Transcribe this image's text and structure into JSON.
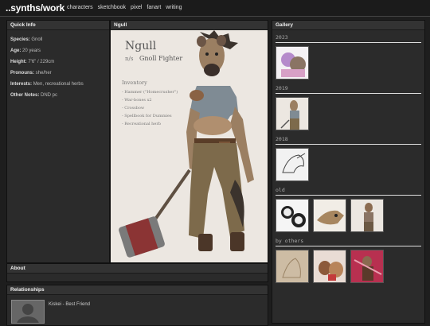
{
  "site": {
    "title": "..synths/work",
    "nav": [
      "characters",
      "sketchbook",
      "pixel",
      "fanart",
      "writing"
    ]
  },
  "quick_info": {
    "header": "Quick Info",
    "rows": [
      {
        "label": "Species:",
        "value": "Gnoll"
      },
      {
        "label": "Age:",
        "value": "20 years"
      },
      {
        "label": "Height:",
        "value": "7'6\" / 229cm"
      },
      {
        "label": "Pronouns:",
        "value": "she/her"
      },
      {
        "label": "Interests:",
        "value": "Men, recreational herbs"
      },
      {
        "label": "Other Notes:",
        "value": "DND pc"
      }
    ]
  },
  "character": {
    "header": "Ngull",
    "art": {
      "name": "Ngull",
      "subtitle": "Gnoll Fighter",
      "prefix": "n/s",
      "inventory_title": "Inventory",
      "inventory": [
        "- Hammer (\"Homecrusher\")",
        "- War-bones x2",
        "- Crossbow",
        "- Spellbook for Dummies",
        "- Recreational herb"
      ]
    }
  },
  "about": {
    "header": "About"
  },
  "relationships": {
    "header": "Relationships",
    "items": [
      {
        "text": "Kiskei - Best Friend"
      }
    ]
  },
  "gallery": {
    "header": "Gallery",
    "sections": [
      {
        "title": "2023",
        "count": 1
      },
      {
        "title": "2019",
        "count": 1
      },
      {
        "title": "2018",
        "count": 1
      },
      {
        "title": "old",
        "count": 3
      },
      {
        "title": "by others",
        "count": 3
      }
    ]
  }
}
